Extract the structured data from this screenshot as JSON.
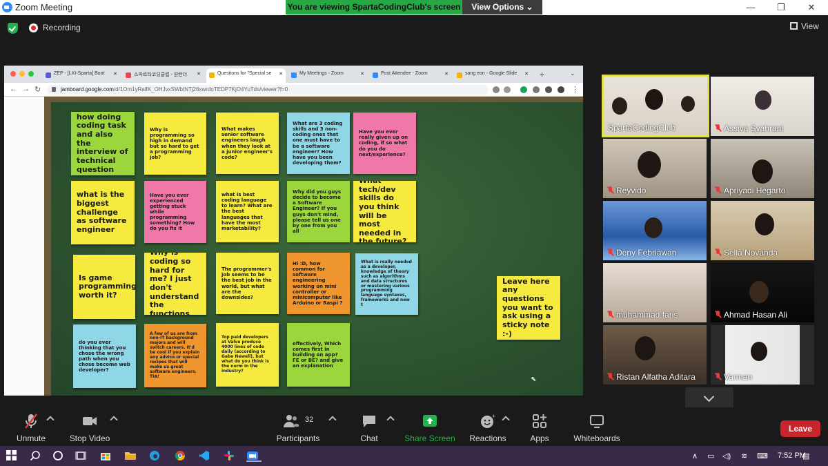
{
  "window": {
    "title": "Zoom Meeting",
    "minimize": "—",
    "maximize": "❐",
    "close": "✕"
  },
  "banner": {
    "viewing_text": "You are viewing SpartaCodingClub's screen",
    "view_options": "View Options ⌄"
  },
  "meeting": {
    "recording": "Recording",
    "view_label": "View"
  },
  "browser": {
    "tabs": [
      {
        "label": "ZEP - [LXI-Sparta] Boot",
        "favicon": "#5b5bd6"
      },
      {
        "label": "스파르타코딩클럽 - 원런더",
        "favicon": "#e84a4a"
      },
      {
        "label": "Questions for \"Special se",
        "favicon": "#f4b400"
      },
      {
        "label": "My Meetings - Zoom",
        "favicon": "#2d8cff"
      },
      {
        "label": "Post Attendee - Zoom",
        "favicon": "#2d8cff"
      },
      {
        "label": "sang eon - Google Slide",
        "favicon": "#f4b400"
      }
    ],
    "url_host": "jamboard.google.com",
    "url_path": "/d/1Om1yRalfK_OHJvxSWbtNTj26xwrdoTEDP7KjO4YuTds/viewer?f=0"
  },
  "notes": [
    {
      "text": "how doing coding task and also the interview of technical question",
      "color": "#9bd63d",
      "size": "big"
    },
    {
      "text": "Why is programming so high in demand but so hard to get a programming job?",
      "color": "#f5ea3d",
      "size": "small"
    },
    {
      "text": "What makes senior software engineers laugh when they look at a junior engineer's code?",
      "color": "#f5ea3d",
      "size": "small"
    },
    {
      "text": "What are 3 coding skills and 3 non-coding ones that one must have to be a software engineer? How have you been developing them?",
      "color": "#8fd6e6",
      "size": "small"
    },
    {
      "text": "Have you ever really given up on coding, if so what do you do next/experience?",
      "color": "#f078a8",
      "size": "small"
    },
    {
      "text": "what is the biggest challenge as software engineer",
      "color": "#f5ea3d",
      "size": "big"
    },
    {
      "text": "Have you ever experienced getting stuck while programming something? How do you fix it",
      "color": "#f078a8",
      "size": "small"
    },
    {
      "text": "what is best coding language to learn? What are the best languages that have the most marketability?",
      "color": "#f5ea3d",
      "size": "small"
    },
    {
      "text": "Why did you guys decide to become a Software Engineer? If you guys don't mind, please tell us one by one from you all",
      "color": "#9bd63d",
      "size": "small"
    },
    {
      "text": "What tech/dev skills do you think will be most needed in the future?",
      "color": "#f5ea3d",
      "size": "big"
    },
    {
      "text": "Is game programming worth it?",
      "color": "#f5ea3d",
      "size": "big"
    },
    {
      "text": "Why is coding so hard for me? I just don't understand the functions.",
      "color": "#f5ea3d",
      "size": "big"
    },
    {
      "text": "The programmer's job seems to be the best job in the world, but what are the downsides?",
      "color": "#f5ea3d",
      "size": "small"
    },
    {
      "text": "Hi :D, how common for software engineering working on mini controller or minicomputer like Arduino or Raspi ?",
      "color": "#f0962e",
      "size": "small"
    },
    {
      "text": "What is really needed as a developer, knowledge of theory such as algorithms and data structures or mastering various programming language syntaxes, frameworks and new t",
      "color": "#8fd6e6",
      "size": "tiny"
    },
    {
      "text": "do you ever thinking that you chose the wrong path when you chose become web developer?",
      "color": "#8fd6e6",
      "size": "small"
    },
    {
      "text": "A few of us are from non-IT background majors and will switch careers. It'd be cool if you explain any advice or special recipes that will make us great software engineers. TIA!",
      "color": "#f0962e",
      "size": "tiny"
    },
    {
      "text": "Top paid developers at Valve produce 4000 lines of code daily (according to Gabe Newell), but what do you think is the norm in the industry?",
      "color": "#f5ea3d",
      "size": "tiny"
    },
    {
      "text": "effectively, Which comes first in building an app? FE or BE? and give an explanation",
      "color": "#9bd63d",
      "size": "small"
    },
    {
      "text": "Leave here any questions you want to ask using a sticky note :-)",
      "color": "#f5ea3d",
      "size": "big"
    }
  ],
  "participants": [
    {
      "name": "SpartaCodingClub",
      "muted": false,
      "active": true
    },
    {
      "name": "Assiva Syahrani",
      "muted": true,
      "active": false
    },
    {
      "name": "Reyvido",
      "muted": true,
      "active": false
    },
    {
      "name": "Apriyadi Hegarto",
      "muted": true,
      "active": false
    },
    {
      "name": "Deny Febriawan",
      "muted": true,
      "active": false
    },
    {
      "name": "Sella Novanda",
      "muted": true,
      "active": false
    },
    {
      "name": "muhammad.faris",
      "muted": true,
      "active": false
    },
    {
      "name": "Ahmad Hasan Ali",
      "muted": true,
      "active": false
    },
    {
      "name": "Ristan Alfatha Aditara",
      "muted": true,
      "active": false
    },
    {
      "name": "Varman",
      "muted": true,
      "active": false
    }
  ],
  "toolbar": {
    "unmute": "Unmute",
    "stop_video": "Stop Video",
    "participants": "Participants",
    "participants_count": "32",
    "chat": "Chat",
    "share_screen": "Share Screen",
    "reactions": "Reactions",
    "apps": "Apps",
    "whiteboards": "Whiteboards",
    "leave": "Leave"
  },
  "taskbar": {
    "time": "7:52 PM"
  },
  "colors": {
    "share_green": "#22b14c",
    "leave_red": "#c8262c",
    "active_speaker": "#e2e24a",
    "banner_green": "#28a745"
  }
}
